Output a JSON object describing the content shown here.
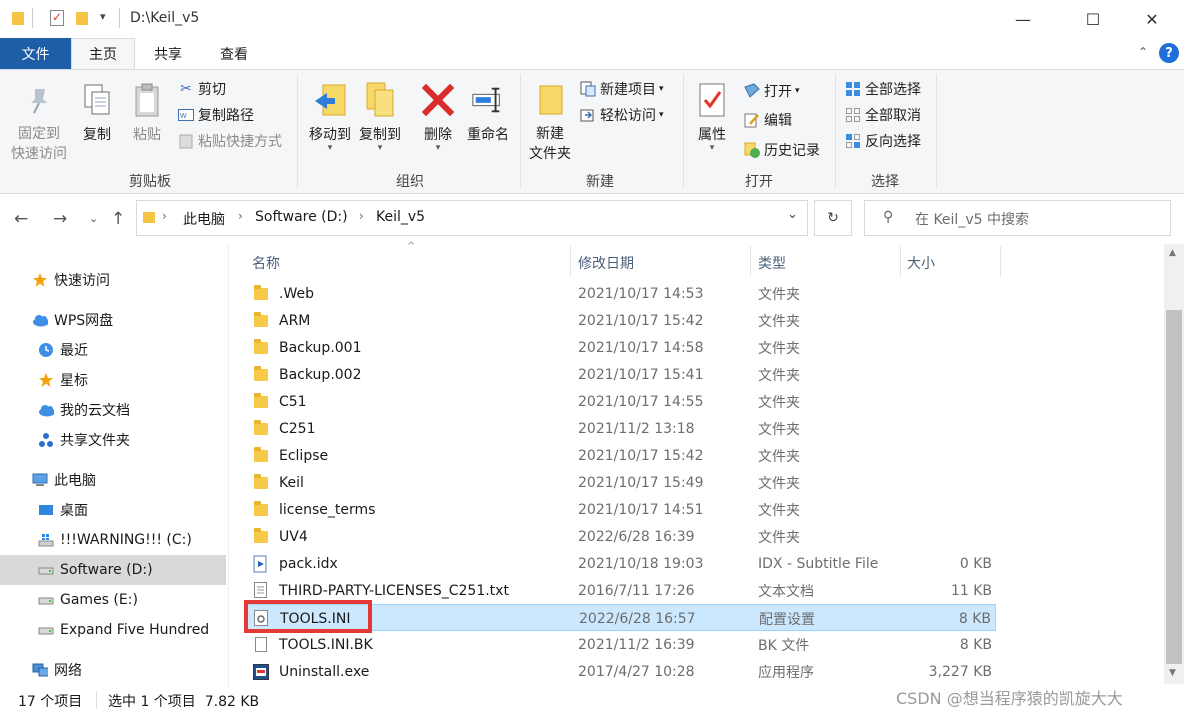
{
  "window": {
    "title": "D:\\Keil_v5",
    "minimize_glyph": "—",
    "maximize_glyph": "☐",
    "close_glyph": "✕"
  },
  "ribbon_tabs": [
    "文件",
    "主页",
    "共享",
    "查看"
  ],
  "ribbon": {
    "clipboard": {
      "pin": "固定到\n快速访问",
      "copy": "复制",
      "paste": "粘贴",
      "cut": "剪切",
      "copy_path": "复制路径",
      "paste_shortcut": "粘贴快捷方式",
      "label": "剪贴板"
    },
    "organize": {
      "move_to": "移动到",
      "copy_to": "复制到",
      "delete": "删除",
      "rename": "重命名",
      "label": "组织"
    },
    "new": {
      "new_folder": "新建\n文件夹",
      "new_item": "新建项目",
      "easy_access": "轻松访问",
      "label": "新建"
    },
    "open": {
      "properties": "属性",
      "open": "打开",
      "edit": "编辑",
      "history": "历史记录",
      "label": "打开"
    },
    "select": {
      "select_all": "全部选择",
      "select_none": "全部取消",
      "invert": "反向选择",
      "label": "选择"
    }
  },
  "address": {
    "crumbs": [
      "此电脑",
      "Software (D:)",
      "Keil_v5"
    ],
    "search_placeholder": "在 Keil_v5 中搜索"
  },
  "nav_pane": [
    {
      "label": "快速访问",
      "icon": "star-icon",
      "indent": 1
    },
    {
      "label": "WPS网盘",
      "icon": "cloud-icon",
      "indent": 1
    },
    {
      "label": "最近",
      "icon": "clock-icon",
      "indent": 2
    },
    {
      "label": "星标",
      "icon": "star-icon",
      "indent": 2
    },
    {
      "label": "我的云文档",
      "icon": "cloud-icon",
      "indent": 2
    },
    {
      "label": "共享文件夹",
      "icon": "share-icon",
      "indent": 2
    },
    {
      "label": "此电脑",
      "icon": "computer-icon",
      "indent": 1
    },
    {
      "label": "桌面",
      "icon": "desktop-icon",
      "indent": 2
    },
    {
      "label": "!!!WARNING!!! (C:)",
      "icon": "windows-drive-icon",
      "indent": 2
    },
    {
      "label": "Software (D:)",
      "icon": "drive-icon",
      "indent": 2,
      "selected": true
    },
    {
      "label": "Games (E:)",
      "icon": "drive-icon",
      "indent": 2
    },
    {
      "label": "Expand Five Hundred",
      "icon": "drive-icon",
      "indent": 2
    },
    {
      "label": "网络",
      "icon": "network-icon",
      "indent": 1
    }
  ],
  "columns": {
    "name": "名称",
    "date": "修改日期",
    "type": "类型",
    "size": "大小"
  },
  "files": [
    {
      "name": ".Web",
      "date": "2021/10/17 14:53",
      "type": "文件夹",
      "size": "",
      "icon": "folder-icon"
    },
    {
      "name": "ARM",
      "date": "2021/10/17 15:42",
      "type": "文件夹",
      "size": "",
      "icon": "folder-icon"
    },
    {
      "name": "Backup.001",
      "date": "2021/10/17 14:58",
      "type": "文件夹",
      "size": "",
      "icon": "folder-icon"
    },
    {
      "name": "Backup.002",
      "date": "2021/10/17 15:41",
      "type": "文件夹",
      "size": "",
      "icon": "folder-icon"
    },
    {
      "name": "C51",
      "date": "2021/10/17 14:55",
      "type": "文件夹",
      "size": "",
      "icon": "folder-icon"
    },
    {
      "name": "C251",
      "date": "2021/11/2 13:18",
      "type": "文件夹",
      "size": "",
      "icon": "folder-icon"
    },
    {
      "name": "Eclipse",
      "date": "2021/10/17 15:42",
      "type": "文件夹",
      "size": "",
      "icon": "folder-icon"
    },
    {
      "name": "Keil",
      "date": "2021/10/17 15:49",
      "type": "文件夹",
      "size": "",
      "icon": "folder-icon"
    },
    {
      "name": "license_terms",
      "date": "2021/10/17 14:51",
      "type": "文件夹",
      "size": "",
      "icon": "folder-icon"
    },
    {
      "name": "UV4",
      "date": "2022/6/28 16:39",
      "type": "文件夹",
      "size": "",
      "icon": "folder-icon"
    },
    {
      "name": "pack.idx",
      "date": "2021/10/18 19:03",
      "type": "IDX - Subtitle File",
      "size": "0 KB",
      "icon": "media-file-icon"
    },
    {
      "name": "THIRD-PARTY-LICENSES_C251.txt",
      "date": "2016/7/11 17:26",
      "type": "文本文档",
      "size": "11 KB",
      "icon": "text-file-icon"
    },
    {
      "name": "TOOLS.INI",
      "date": "2022/6/28 16:57",
      "type": "配置设置",
      "size": "8 KB",
      "icon": "settings-file-icon",
      "selected": true
    },
    {
      "name": "TOOLS.INI.BK",
      "date": "2021/11/2 16:39",
      "type": "BK 文件",
      "size": "8 KB",
      "icon": "file-icon"
    },
    {
      "name": "Uninstall.exe",
      "date": "2017/4/27 10:28",
      "type": "应用程序",
      "size": "3,227 KB",
      "icon": "exe-icon"
    }
  ],
  "status": {
    "count": "17 个项目",
    "selection": "选中 1 个项目  7.82 KB"
  },
  "watermark": "CSDN @想当程序猿的凯旋大大",
  "colors": {
    "accent": "#1e5ea8",
    "selection": "#cce8ff",
    "highlight_box": "#e53935"
  }
}
